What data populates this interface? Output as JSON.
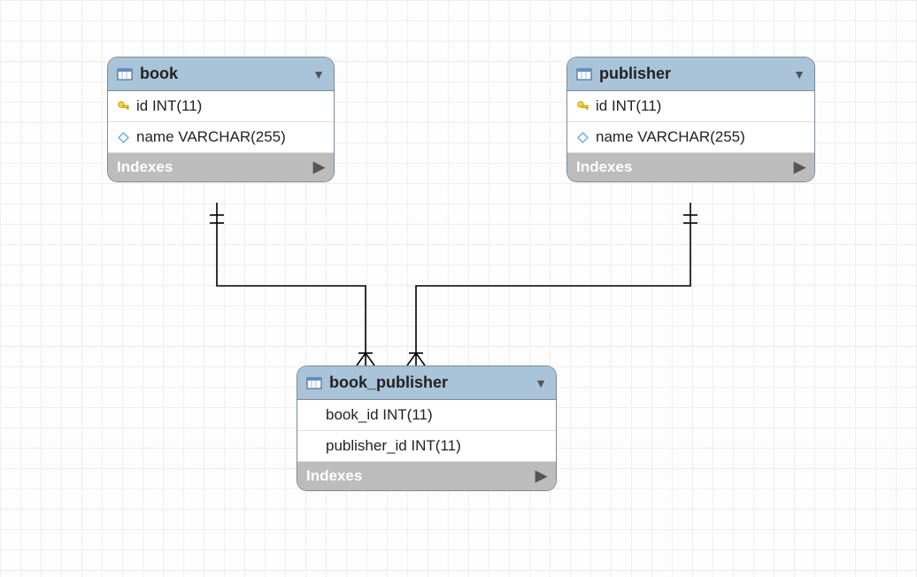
{
  "tables": {
    "book": {
      "title": "book",
      "columns": [
        {
          "icon": "key",
          "text": "id INT(11)"
        },
        {
          "icon": "diamond",
          "text": "name VARCHAR(255)"
        }
      ],
      "indexes_label": "Indexes"
    },
    "publisher": {
      "title": "publisher",
      "columns": [
        {
          "icon": "key",
          "text": "id INT(11)"
        },
        {
          "icon": "diamond",
          "text": "name VARCHAR(255)"
        }
      ],
      "indexes_label": "Indexes"
    },
    "book_publisher": {
      "title": "book_publisher",
      "columns": [
        {
          "icon": "none",
          "text": "book_id INT(11)"
        },
        {
          "icon": "none",
          "text": "publisher_id INT(11)"
        }
      ],
      "indexes_label": "Indexes"
    }
  }
}
